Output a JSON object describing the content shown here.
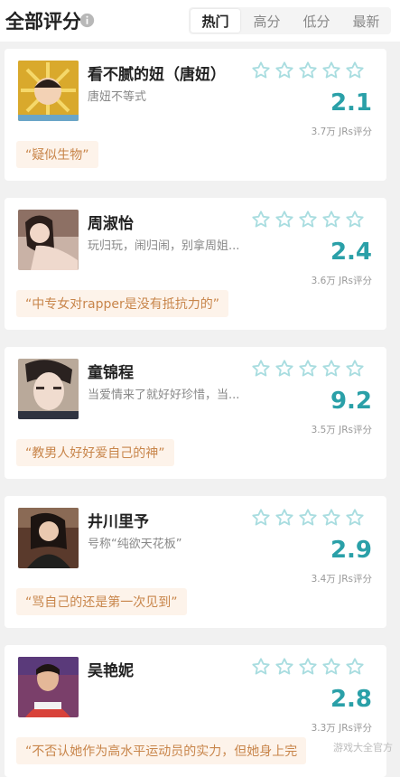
{
  "header": {
    "title": "全部评分",
    "tabs": [
      "热门",
      "高分",
      "低分",
      "最新"
    ],
    "active_tab": 0
  },
  "cards": [
    {
      "name": "看不腻的妞（唐妞）",
      "subtitle": "唐妞不等式",
      "score": "2.1",
      "count": "3.7万 JRs评分",
      "quote": "“疑似生物”",
      "avatar_color": "#e8c93c"
    },
    {
      "name": "周淑怡",
      "subtitle": "玩归玩，闹归闹，别拿周姐...",
      "score": "2.4",
      "count": "3.6万 JRs评分",
      "quote": "“中专女对rapper是没有抵抗力的”",
      "avatar_color": "#b89c8f"
    },
    {
      "name": "童锦程",
      "subtitle": "当爱情来了就好好珍惜，当...",
      "score": "9.2",
      "count": "3.5万 JRs评分",
      "quote": "“教男人好好爱自己的神”",
      "avatar_color": "#c9b6a2"
    },
    {
      "name": "井川里予",
      "subtitle": "号称“纯欲天花板”",
      "score": "2.9",
      "count": "3.4万 JRs评分",
      "quote": "“骂自己的还是第一次见到”",
      "avatar_color": "#6f4a38"
    },
    {
      "name": "吴艳妮",
      "subtitle": "",
      "score": "2.8",
      "count": "3.3万 JRs评分",
      "quote": "“不否认她作为高水平运动员的实力，但她身上完",
      "avatar_color": "#d8423a"
    }
  ],
  "watermark": "游戏大全官方",
  "colors": {
    "accent": "#2aa0a8",
    "star": "#a9dde0",
    "quote_bg": "#fdf3ea",
    "quote_text": "#c8854a"
  }
}
